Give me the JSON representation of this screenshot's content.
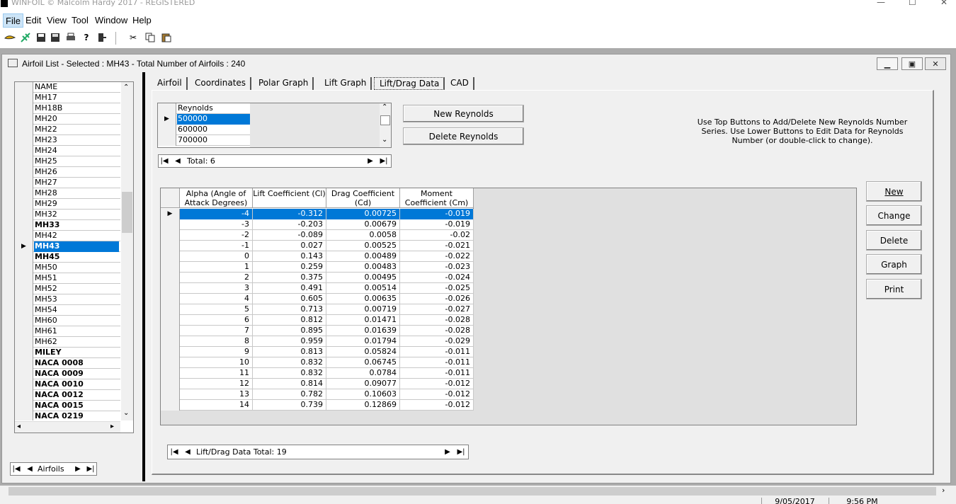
{
  "app": {
    "title": "WINFOIL © Malcolm Hardy 2017 - REGISTERED"
  },
  "menu": [
    {
      "label": "File"
    },
    {
      "label": "Edit"
    },
    {
      "label": "View"
    },
    {
      "label": "Tool"
    },
    {
      "label": "Window"
    },
    {
      "label": "Help"
    }
  ],
  "window": {
    "title": "Airfoil List - Selected : MH43 - Total Number of Airfoils : 240"
  },
  "airfoil_list": {
    "header": "NAME",
    "items": [
      {
        "name": "MH17",
        "bold": false,
        "selected": false
      },
      {
        "name": "MH18B",
        "bold": false,
        "selected": false
      },
      {
        "name": "MH20",
        "bold": false,
        "selected": false
      },
      {
        "name": "MH22",
        "bold": false,
        "selected": false
      },
      {
        "name": "MH23",
        "bold": false,
        "selected": false
      },
      {
        "name": "MH24",
        "bold": false,
        "selected": false
      },
      {
        "name": "MH25",
        "bold": false,
        "selected": false
      },
      {
        "name": "MH26",
        "bold": false,
        "selected": false
      },
      {
        "name": "MH27",
        "bold": false,
        "selected": false
      },
      {
        "name": "MH28",
        "bold": false,
        "selected": false
      },
      {
        "name": "MH29",
        "bold": false,
        "selected": false
      },
      {
        "name": "MH32",
        "bold": false,
        "selected": false
      },
      {
        "name": "MH33",
        "bold": true,
        "selected": false
      },
      {
        "name": "MH42",
        "bold": false,
        "selected": false
      },
      {
        "name": "MH43",
        "bold": true,
        "selected": true
      },
      {
        "name": "MH45",
        "bold": true,
        "selected": false
      },
      {
        "name": "MH50",
        "bold": false,
        "selected": false
      },
      {
        "name": "MH51",
        "bold": false,
        "selected": false
      },
      {
        "name": "MH52",
        "bold": false,
        "selected": false
      },
      {
        "name": "MH53",
        "bold": false,
        "selected": false
      },
      {
        "name": "MH54",
        "bold": false,
        "selected": false
      },
      {
        "name": "MH60",
        "bold": false,
        "selected": false
      },
      {
        "name": "MH61",
        "bold": false,
        "selected": false
      },
      {
        "name": "MH62",
        "bold": false,
        "selected": false
      },
      {
        "name": "MILEY",
        "bold": true,
        "selected": false
      },
      {
        "name": "NACA 0008",
        "bold": true,
        "selected": false
      },
      {
        "name": "NACA 0009",
        "bold": true,
        "selected": false
      },
      {
        "name": "NACA 0010",
        "bold": true,
        "selected": false
      },
      {
        "name": "NACA 0012",
        "bold": true,
        "selected": false
      },
      {
        "name": "NACA 0015",
        "bold": true,
        "selected": false
      },
      {
        "name": "NACA 0219",
        "bold": true,
        "selected": false
      }
    ],
    "nav_label": "Airfoils"
  },
  "tabs": [
    {
      "label": "Airfoil",
      "active": false
    },
    {
      "label": "Coordinates",
      "active": false
    },
    {
      "label": "Polar Graph",
      "active": false
    },
    {
      "label": "Lift Graph",
      "active": false
    },
    {
      "label": "Lift/Drag Data",
      "active": true
    },
    {
      "label": "CAD",
      "active": false
    }
  ],
  "reynolds": {
    "header": "Reynolds",
    "rows": [
      {
        "value": "500000",
        "selected": true
      },
      {
        "value": "600000",
        "selected": false
      },
      {
        "value": "700000",
        "selected": false
      }
    ],
    "total_label": "Total: 6",
    "new_button": "New Reynolds",
    "delete_button": "Delete Reynolds"
  },
  "instructions": "Use Top Buttons to Add/Delete New Reynolds Number Series. Use Lower Buttons to Edit Data for Reynolds Number (or double-click to change).",
  "lift_drag": {
    "columns": [
      "Alpha (Angle of Attack Degrees)",
      "Lift Coefficient (Cl)",
      "Drag Coefficient (Cd)",
      "Moment Coefficient (Cm)"
    ],
    "rows": [
      [
        "-4",
        "-0.312",
        "0.00725",
        "-0.019"
      ],
      [
        "-3",
        "-0.203",
        "0.00679",
        "-0.019"
      ],
      [
        "-2",
        "-0.089",
        "0.0058",
        "-0.02"
      ],
      [
        "-1",
        "0.027",
        "0.00525",
        "-0.021"
      ],
      [
        "0",
        "0.143",
        "0.00489",
        "-0.022"
      ],
      [
        "1",
        "0.259",
        "0.00483",
        "-0.023"
      ],
      [
        "2",
        "0.375",
        "0.00495",
        "-0.024"
      ],
      [
        "3",
        "0.491",
        "0.00514",
        "-0.025"
      ],
      [
        "4",
        "0.605",
        "0.00635",
        "-0.026"
      ],
      [
        "5",
        "0.713",
        "0.00719",
        "-0.027"
      ],
      [
        "6",
        "0.812",
        "0.01471",
        "-0.028"
      ],
      [
        "7",
        "0.895",
        "0.01639",
        "-0.028"
      ],
      [
        "8",
        "0.959",
        "0.01794",
        "-0.029"
      ],
      [
        "9",
        "0.813",
        "0.05824",
        "-0.011"
      ],
      [
        "10",
        "0.832",
        "0.06745",
        "-0.011"
      ],
      [
        "11",
        "0.832",
        "0.0784",
        "-0.011"
      ],
      [
        "12",
        "0.814",
        "0.09077",
        "-0.012"
      ],
      [
        "13",
        "0.782",
        "0.10603",
        "-0.012"
      ],
      [
        "14",
        "0.739",
        "0.12869",
        "-0.012"
      ]
    ],
    "total_label": "Lift/Drag Data Total: 19"
  },
  "action_buttons": [
    {
      "label": "New"
    },
    {
      "label": "Change"
    },
    {
      "label": "Delete"
    },
    {
      "label": "Graph"
    },
    {
      "label": "Print"
    }
  ],
  "status": {
    "date": "9/05/2017",
    "time": "9:56 PM"
  },
  "colors": {
    "selection": "#0078d7",
    "mdi_background": "#ababab",
    "panel": "#f0f0f0"
  }
}
